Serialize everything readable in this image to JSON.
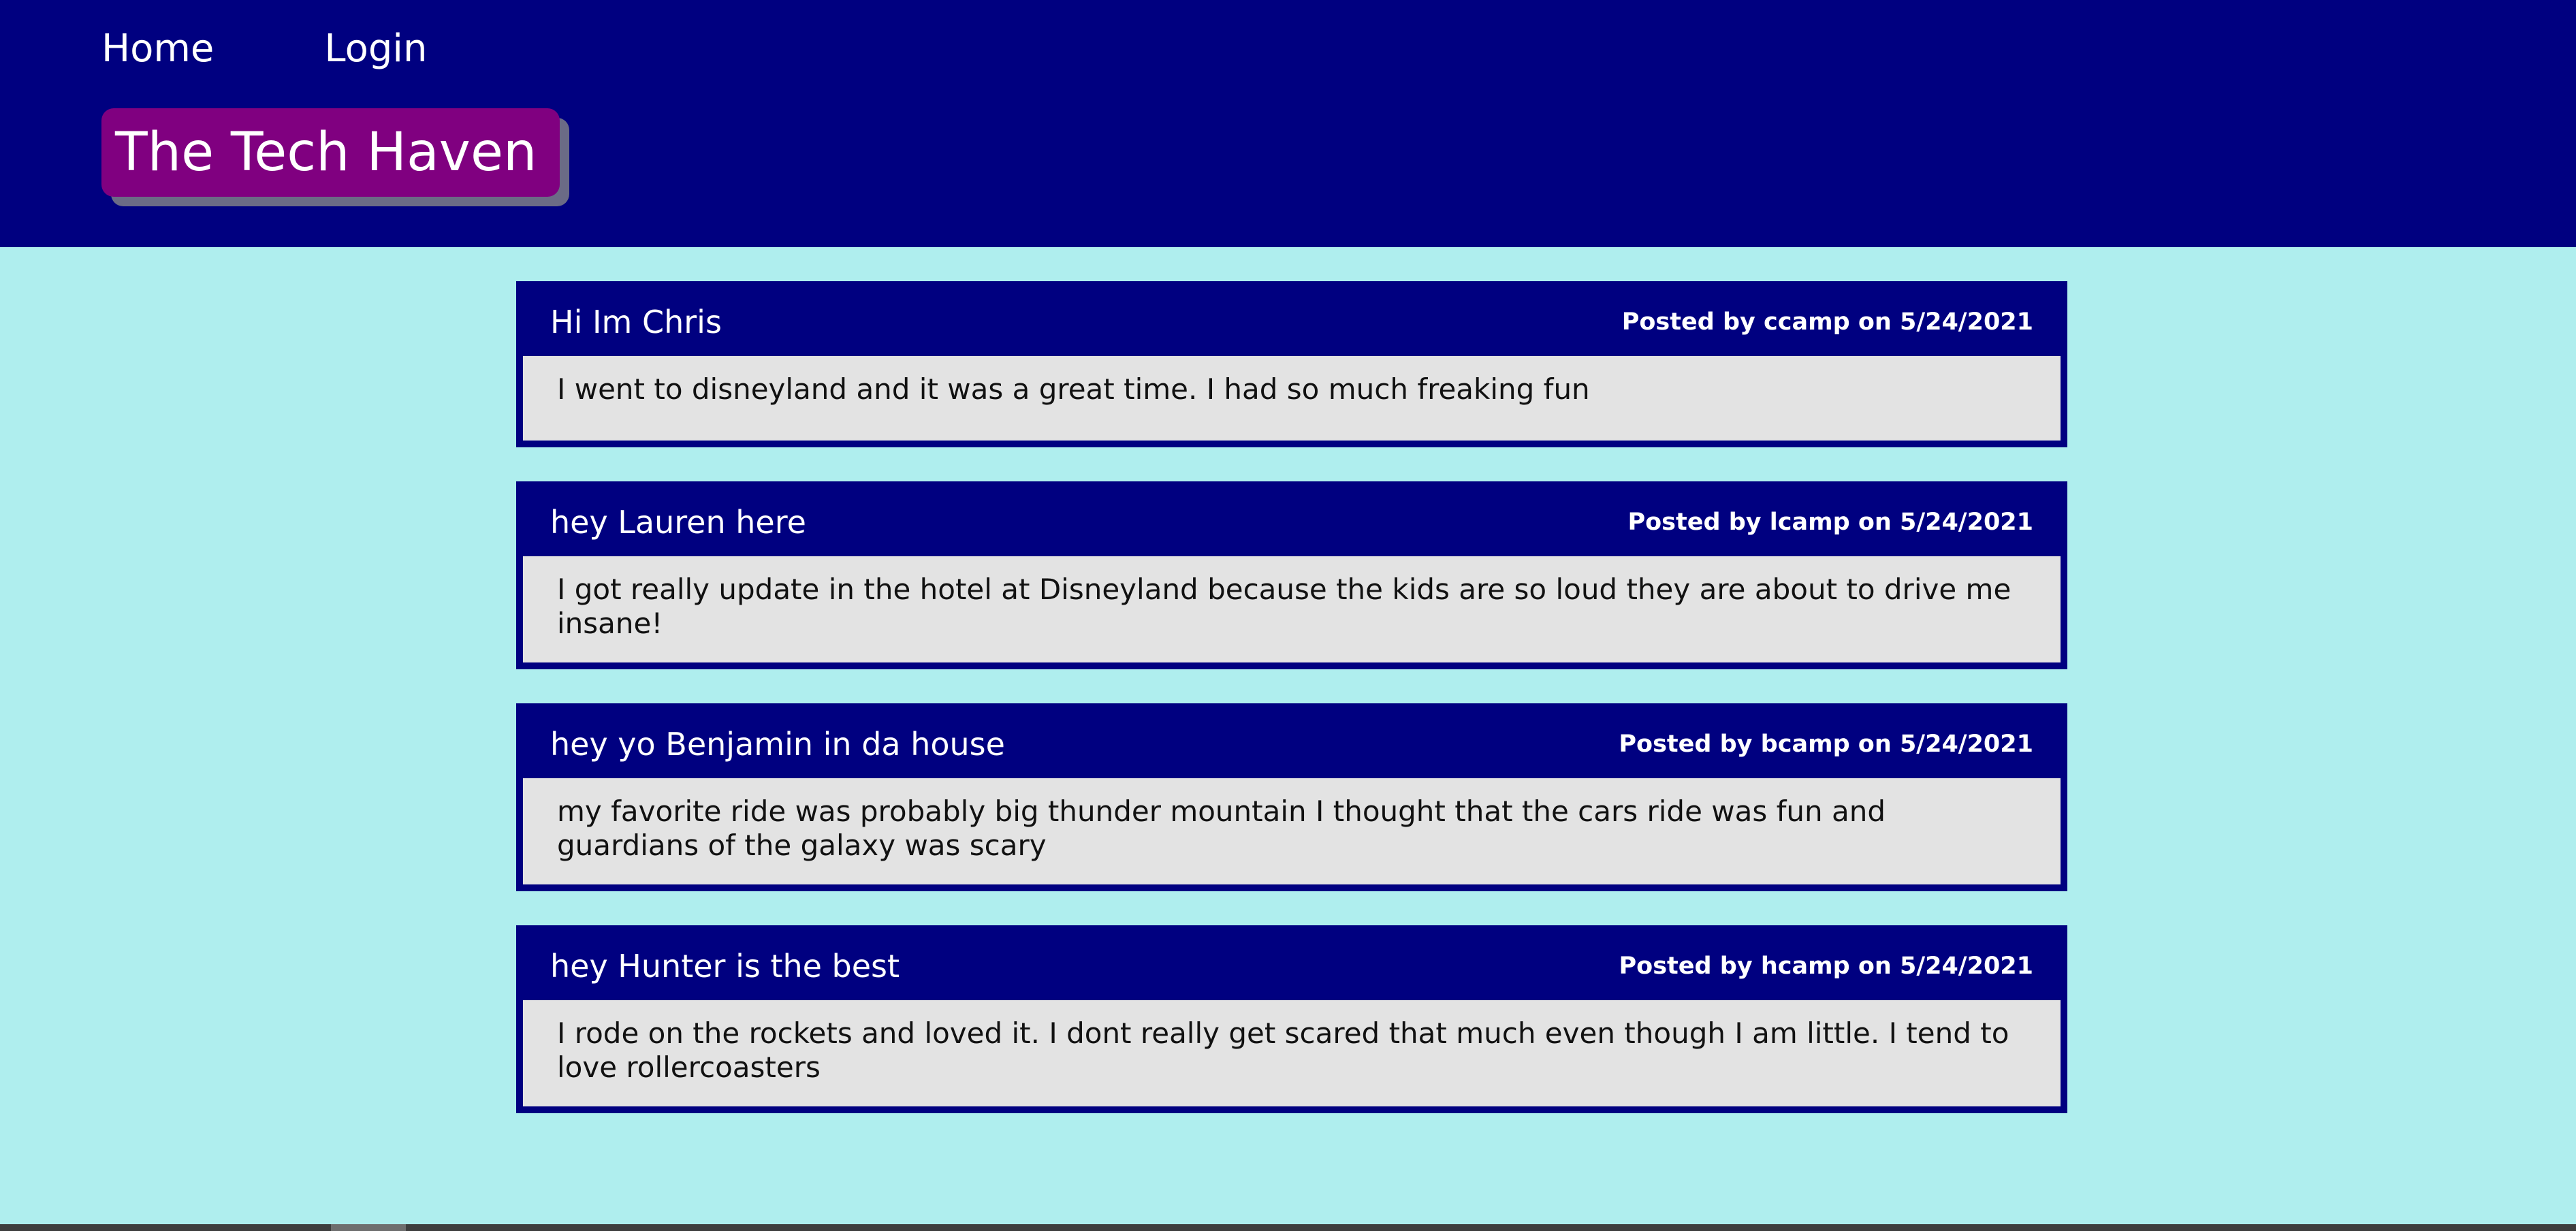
{
  "nav": {
    "home": "Home",
    "login": "Login"
  },
  "brand": {
    "title": "The Tech Haven"
  },
  "posts": [
    {
      "title": "Hi Im Chris",
      "meta": "Posted by ccamp on 5/24/2021",
      "body": "I went to disneyland and it was a great time. I had so much freaking fun"
    },
    {
      "title": "hey Lauren here",
      "meta": "Posted by lcamp on 5/24/2021",
      "body": "I got really update in the hotel at Disneyland because the kids are so loud they are about to drive me insane!"
    },
    {
      "title": "hey yo Benjamin in da house",
      "meta": "Posted by bcamp on 5/24/2021",
      "body": "my favorite ride was probably big thunder mountain I thought that the cars ride was fun and guardians of the galaxy was scary"
    },
    {
      "title": "hey Hunter is the best",
      "meta": "Posted by hcamp on 5/24/2021",
      "body": "I rode on the rockets and loved it. I dont really get scared that much even though I am little. I tend to love rollercoasters"
    }
  ],
  "colors": {
    "header": "#000080",
    "background": "#afeeee",
    "brand": "#800080",
    "post_body": "#e3e3e3"
  }
}
